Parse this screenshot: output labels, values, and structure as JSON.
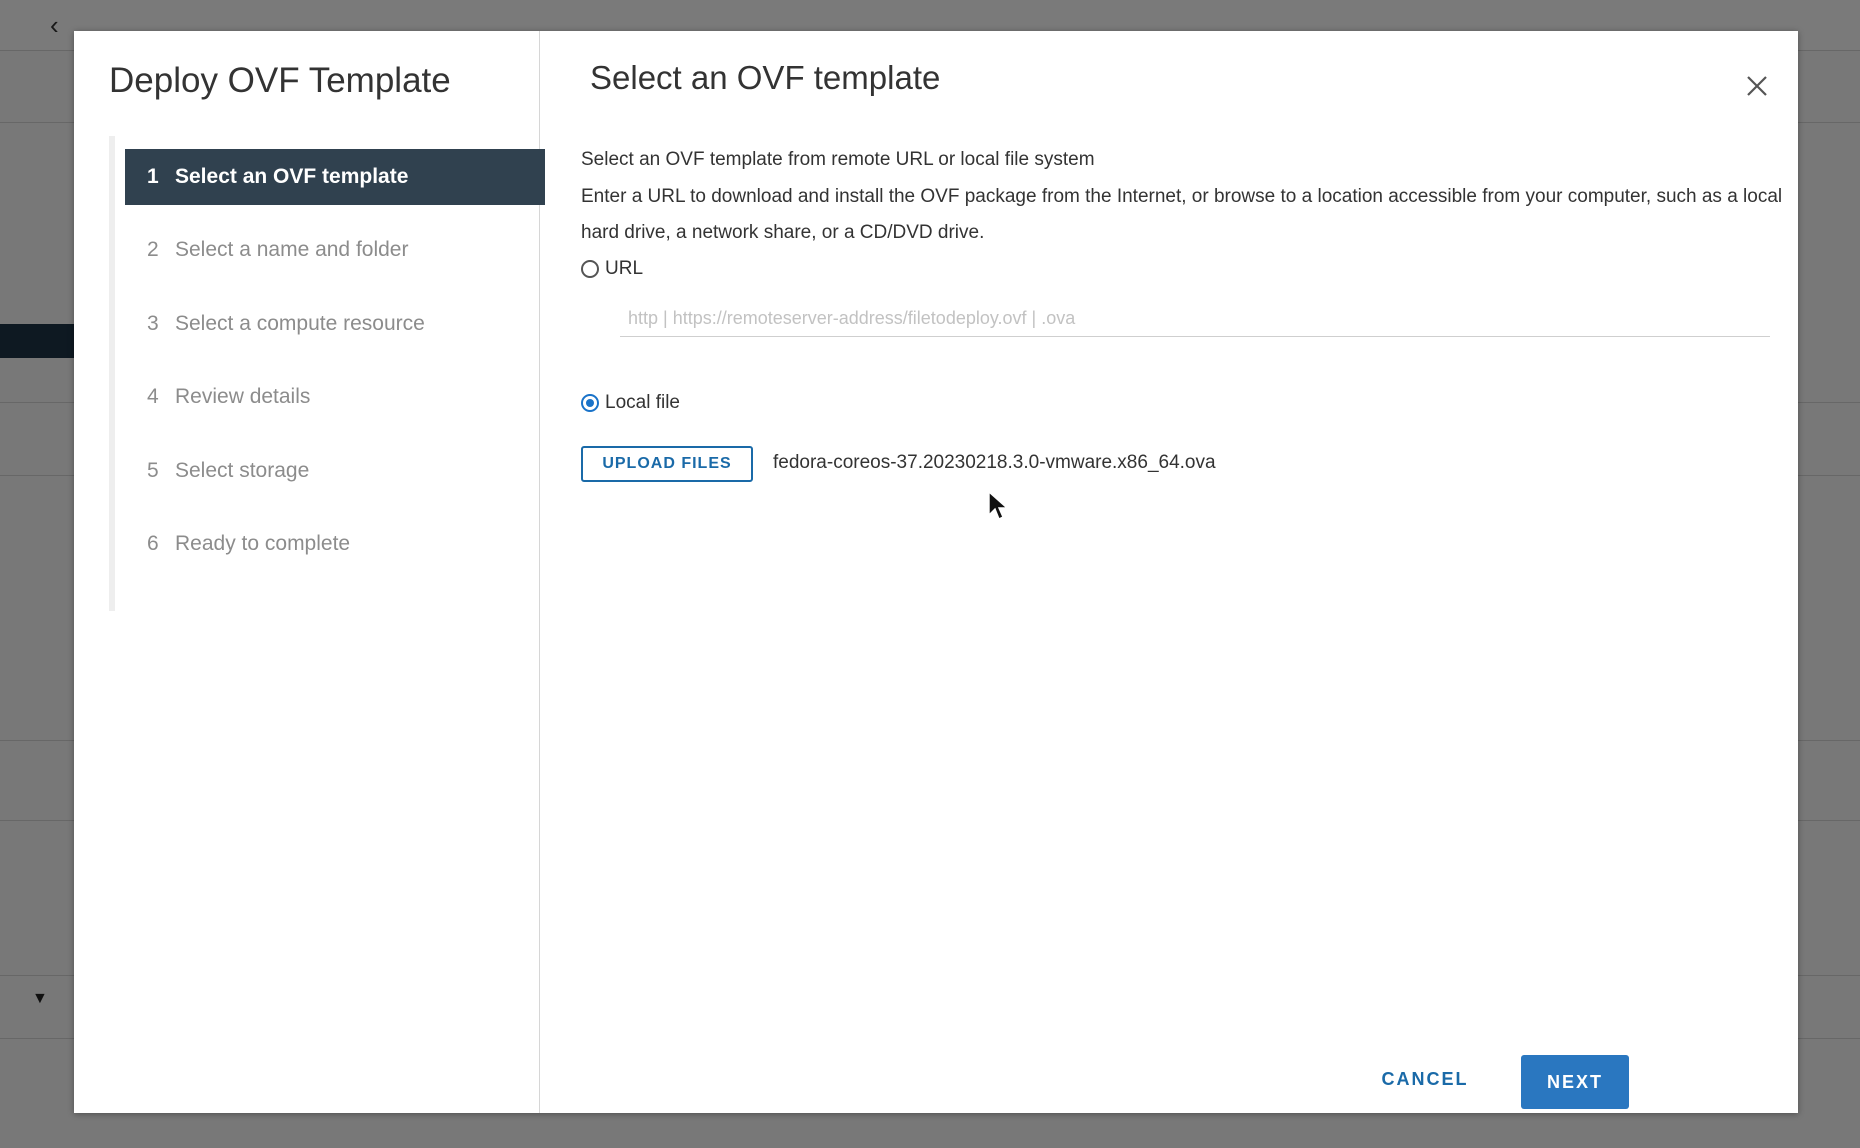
{
  "dialog": {
    "title": "Deploy OVF Template",
    "close_icon": "close-icon"
  },
  "steps": [
    {
      "number": "1",
      "label": "Select an OVF template",
      "active": true
    },
    {
      "number": "2",
      "label": "Select a name and folder",
      "active": false
    },
    {
      "number": "3",
      "label": "Select a compute resource",
      "active": false
    },
    {
      "number": "4",
      "label": "Review details",
      "active": false
    },
    {
      "number": "5",
      "label": "Select storage",
      "active": false
    },
    {
      "number": "6",
      "label": "Ready to complete",
      "active": false
    }
  ],
  "content": {
    "title": "Select an OVF template",
    "subtitle": "Select an OVF template from remote URL or local file system",
    "description": "Enter a URL to download and install the OVF package from the Internet, or browse to a location accessible from your computer, such as a local hard drive, a network share, or a CD/DVD drive.",
    "url_option": {
      "label": "URL",
      "selected": false,
      "value": "",
      "placeholder": "http | https://remoteserver-address/filetodeploy.ovf | .ova"
    },
    "local_option": {
      "label": "Local file",
      "selected": true
    },
    "upload_button": "UPLOAD FILES",
    "file_name": "fedora-coreos-37.20230218.3.0-vmware.x86_64.ova"
  },
  "footer": {
    "cancel": "CANCEL",
    "next": "NEXT"
  },
  "background": {
    "back_icon": "chevron-left-icon",
    "filter_icon": "filter-icon"
  },
  "colors": {
    "accent": "#1a6aa8",
    "primary_button": "#2a77c0",
    "active_step": "#30414f",
    "radio_checked": "#1a73c9"
  }
}
